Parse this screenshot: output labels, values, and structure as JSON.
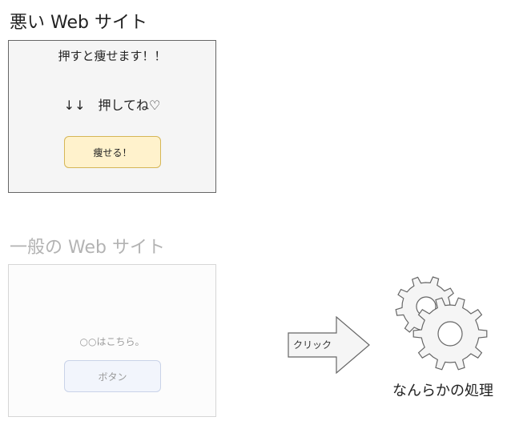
{
  "bad_site": {
    "title": "悪い Web サイト",
    "heading": "押すと痩せます！！",
    "arrow_text": "↓↓　押してね♡",
    "button_label": "痩せる！"
  },
  "normal_site": {
    "title": "一般の Web サイト",
    "note": "○○はこちら。",
    "button_label": "ボタン"
  },
  "flow": {
    "arrow_label": "クリック",
    "process_label": "なんらかの処理",
    "process_icon": "gears-icon"
  },
  "colors": {
    "bad_button_fill": "#fff2cc",
    "bad_button_border": "#d6b656",
    "normal_button_fill": "#f2f5fc",
    "panel_fill": "#f5f5f5"
  }
}
